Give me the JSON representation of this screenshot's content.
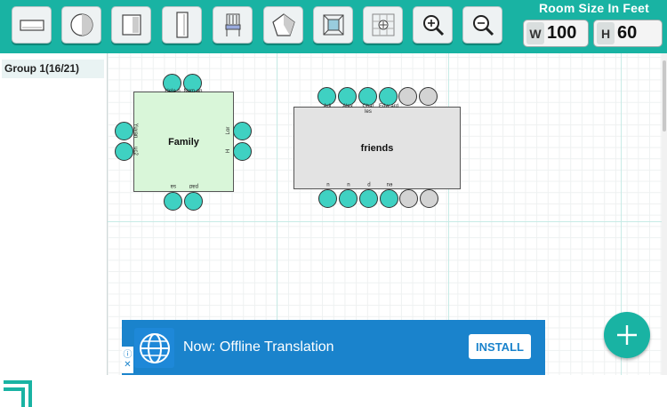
{
  "toolbar": {
    "tools": [
      {
        "name": "rect-table-tool-icon"
      },
      {
        "name": "round-table-tool-icon"
      },
      {
        "name": "square-table-tool-icon"
      },
      {
        "name": "long-table-tool-icon"
      },
      {
        "name": "chair-tool-icon"
      },
      {
        "name": "pentagon-tool-icon"
      },
      {
        "name": "fit-screen-icon"
      },
      {
        "name": "grid-center-icon"
      },
      {
        "name": "zoom-in-icon"
      },
      {
        "name": "zoom-out-icon"
      }
    ],
    "room_size_title": "Room Size In Feet",
    "width_prefix": "W",
    "width_value": "100",
    "height_prefix": "H",
    "height_value": "60"
  },
  "sidebar": {
    "group_label": "Group 1(16/21)"
  },
  "tables": {
    "family": {
      "name": "Family",
      "top_labels": [
        "Hele n",
        "Nom an"
      ],
      "left_labels": [
        "Yuvan",
        "uc2"
      ],
      "right_labels": [
        "Lor",
        "H"
      ],
      "bottom_labels": [
        "sa",
        "pad"
      ]
    },
    "friends": {
      "name": "friends",
      "top_labels": [
        "Adi",
        "Alex",
        "Char les",
        "Edw ard"
      ],
      "bottom_labels": [
        "u",
        "u",
        "p",
        "eu"
      ]
    }
  },
  "ad": {
    "text": "Now: Offline Translation",
    "install_label": "INSTALL",
    "info_icon": "ⓘ",
    "close_icon": "✕"
  },
  "colors": {
    "accent": "#19b3a3",
    "seat_filled": "#3fd1c2",
    "seat_empty": "#d3d3d3",
    "family_table": "#d9f6d9",
    "friends_table": "#e3e3e3",
    "ad_background": "#1a83cc"
  }
}
